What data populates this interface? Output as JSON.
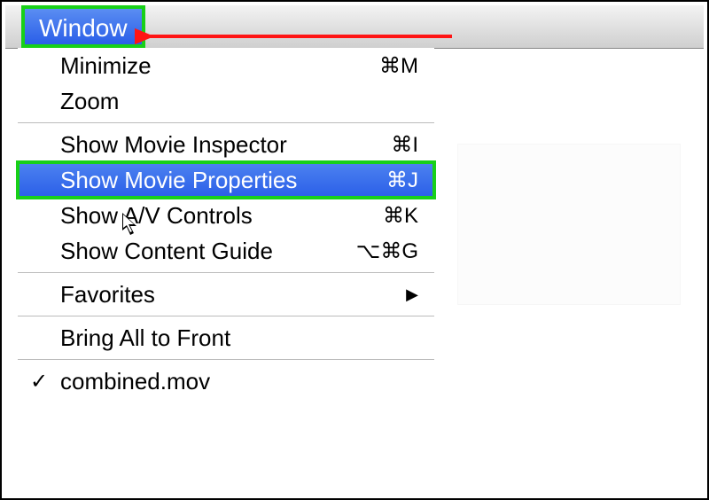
{
  "menubar": {
    "title": "Window"
  },
  "menu": {
    "items": [
      {
        "label": "Minimize",
        "shortcut": "⌘M"
      },
      {
        "label": "Zoom",
        "shortcut": ""
      },
      {
        "sep": true
      },
      {
        "label": "Show Movie Inspector",
        "shortcut": "⌘I"
      },
      {
        "label": "Show Movie Properties",
        "shortcut": "⌘J",
        "selected": true
      },
      {
        "label": "Show A/V Controls",
        "shortcut": "⌘K"
      },
      {
        "label": "Show Content Guide",
        "shortcut": "⌥⌘G"
      },
      {
        "sep": true
      },
      {
        "label": "Favorites",
        "submenu": true
      },
      {
        "sep": true
      },
      {
        "label": "Bring All to Front",
        "shortcut": ""
      },
      {
        "sep": true
      },
      {
        "label": "combined.mov",
        "checked": true
      }
    ]
  }
}
